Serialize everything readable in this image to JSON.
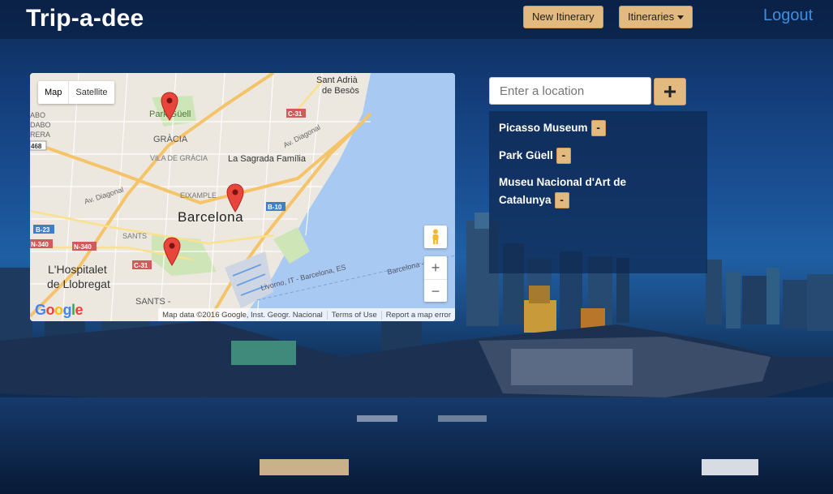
{
  "navbar": {
    "brand": "Trip-a-dee",
    "new_itinerary": "New Itinerary",
    "itineraries": "Itineraries",
    "logout": "Logout"
  },
  "map": {
    "type_map": "Map",
    "type_satellite": "Satellite",
    "labels": {
      "sant_adria": "Sant Adrià",
      "de_besos": "de Besòs",
      "park_guell": "Park Güell",
      "gracia": "GRÀCIA",
      "vila_de_gracia": "VILA DE GRÀCIA",
      "sagrada": "La Sagrada Família",
      "av_diagonal_1": "Av. Diagonal",
      "av_diagonal_2": "Av. Diagonal",
      "eixample": "EIXAMPLE",
      "barcelona": "Barcelona",
      "sants": "SANTS",
      "hospitalet_1": "L'Hospitalet",
      "hospitalet_2": "de Llobregat",
      "sants_m": "SANTS -",
      "livorno": "Livorno, IT - Barcelona, ES",
      "barcelona_ferry": "Barcelona -",
      "abo": "ABO",
      "dabo": "DABO",
      "rera": "RERA"
    },
    "road_shields": [
      "C-31",
      "C-31",
      "B-10",
      "B-23",
      "N-340",
      "N-340",
      "468"
    ],
    "zoom_in": "+",
    "zoom_out": "−",
    "google": "Google",
    "attribution": {
      "data": "Map data ©2016 Google, Inst. Geogr. Nacional",
      "terms": "Terms of Use",
      "report": "Report a map error"
    }
  },
  "search": {
    "placeholder": "Enter a location",
    "add_icon": "plus-icon"
  },
  "locations": [
    {
      "name": "Picasso Museum",
      "remove": "-"
    },
    {
      "name": "Park Güell",
      "remove": "-"
    },
    {
      "name_line1": "Museu Nacional d'Art de",
      "name_line2": "Catalunya",
      "remove": "-"
    }
  ],
  "colors": {
    "accent_button": "#e2b97e",
    "logout_link": "#3f8fe0",
    "pin": "#e8453c"
  }
}
